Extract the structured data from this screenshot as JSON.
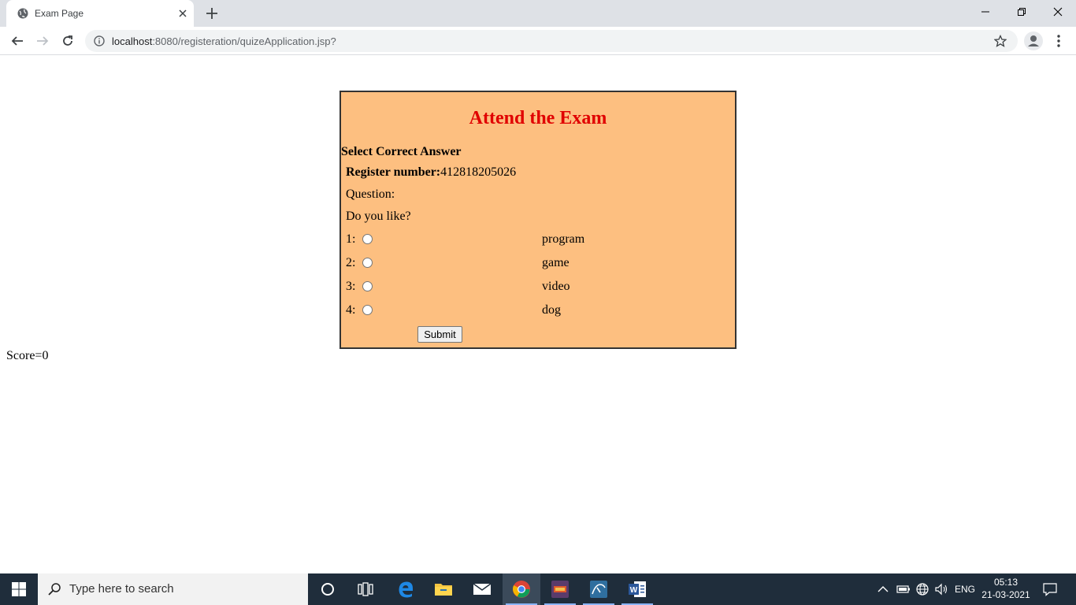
{
  "browser": {
    "tab_title": "Exam Page",
    "url_host": "localhost",
    "url_path": ":8080/registeration/quizeApplication.jsp?"
  },
  "exam": {
    "title": "Attend the Exam",
    "select_label": "Select Correct Answer",
    "register_label": "Register number:",
    "register_value": "412818205026",
    "question_label": "Question:",
    "question_text": "Do you like?",
    "options": [
      {
        "num": "1:",
        "text": "program"
      },
      {
        "num": "2:",
        "text": "game"
      },
      {
        "num": "3:",
        "text": "video"
      },
      {
        "num": "4:",
        "text": "dog"
      }
    ],
    "submit_label": "Submit",
    "score_text": "Score=0"
  },
  "taskbar": {
    "search_placeholder": "Type here to search",
    "language": "ENG",
    "time": "05:13",
    "date": "21-03-2021"
  },
  "colors": {
    "exam_bg": "#fdbf80",
    "title": "#e00000",
    "taskbar": "#1f2d3b"
  }
}
